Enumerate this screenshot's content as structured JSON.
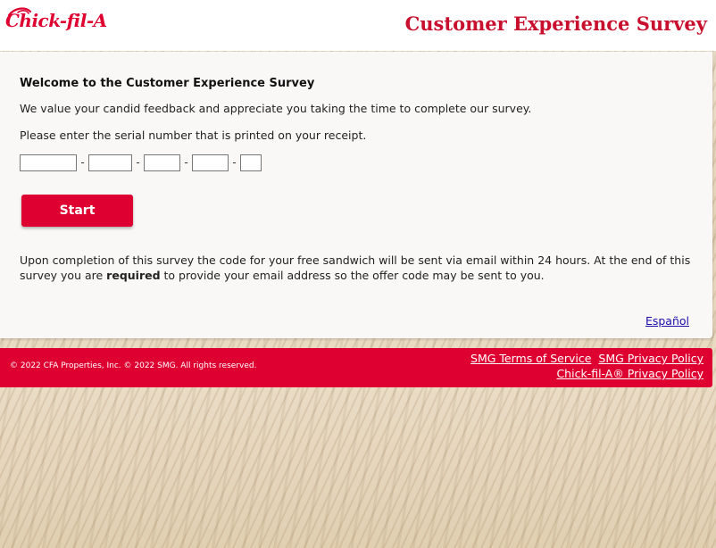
{
  "header": {
    "logo_text": "Chick-fil-A",
    "title": "Customer Experience Survey"
  },
  "main": {
    "welcome": "Welcome to the Customer Experience Survey",
    "intro": "We value your candid feedback and appreciate you taking the time to complete our survey.",
    "serial_prompt": "Please enter the serial number that is printed on your receipt.",
    "serial_fields": [
      "",
      "",
      "",
      "",
      ""
    ],
    "dash": "-",
    "start_label": "Start",
    "notice_part1": "Upon completion of this survey the code for your free sandwich will be sent via email within 24 hours. At the end of this survey you are ",
    "notice_bold": "required",
    "notice_part2": " to provide your email address so the offer code may be sent to you.",
    "language_link": "Español"
  },
  "footer": {
    "copyright": "© 2022 CFA Properties, Inc. © 2022 SMG. All rights reserved.",
    "terms_link": "SMG Terms of Service",
    "privacy_link": "SMG Privacy Policy",
    "cfa_privacy_link": "Chick-fil-A® Privacy Policy"
  },
  "colors": {
    "brand_red": "#dd0031",
    "title_red": "#c8102e",
    "link_blue": "#1a0dab"
  }
}
